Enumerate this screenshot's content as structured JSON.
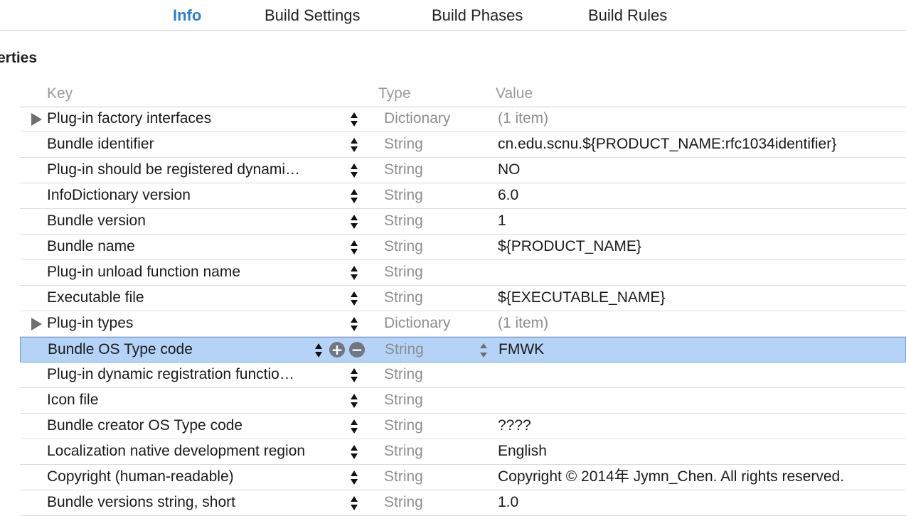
{
  "tabs": [
    {
      "label": "Info",
      "active": true
    },
    {
      "label": "Build Settings",
      "active": false
    },
    {
      "label": "Build Phases",
      "active": false
    },
    {
      "label": "Build Rules",
      "active": false
    }
  ],
  "section_title": "erties",
  "columns": {
    "key": "Key",
    "type": "Type",
    "value": "Value"
  },
  "colors": {
    "accent": "#2f7bd8",
    "selection": "#b5d3f7",
    "muted_text": "#8e8e8e"
  },
  "icons": {
    "disclosure": "disclosure-triangle-icon",
    "stepper": "up-down-stepper-icon",
    "add": "plus-circle-icon",
    "remove": "minus-circle-icon"
  },
  "rows": [
    {
      "key": "Plug-in factory interfaces",
      "type": "Dictionary",
      "value": "(1 item)",
      "expandable": true
    },
    {
      "key": "Bundle identifier",
      "type": "String",
      "value": "cn.edu.scnu.${PRODUCT_NAME:rfc1034identifier}"
    },
    {
      "key": "Plug-in should be registered dynami…",
      "type": "String",
      "value": "NO"
    },
    {
      "key": "InfoDictionary version",
      "type": "String",
      "value": "6.0"
    },
    {
      "key": "Bundle version",
      "type": "String",
      "value": "1"
    },
    {
      "key": "Bundle name",
      "type": "String",
      "value": "${PRODUCT_NAME}"
    },
    {
      "key": "Plug-in unload function name",
      "type": "String",
      "value": ""
    },
    {
      "key": "Executable file",
      "type": "String",
      "value": "${EXECUTABLE_NAME}"
    },
    {
      "key": "Plug-in types",
      "type": "Dictionary",
      "value": "(1 item)",
      "expandable": true
    },
    {
      "key": "Bundle OS Type code",
      "type": "String",
      "value": "FMWK",
      "selected": true
    },
    {
      "key": "Plug-in dynamic registration functio…",
      "type": "String",
      "value": ""
    },
    {
      "key": "Icon file",
      "type": "String",
      "value": ""
    },
    {
      "key": "Bundle creator OS Type code",
      "type": "String",
      "value": "????"
    },
    {
      "key": "Localization native development region",
      "type": "String",
      "value": "English"
    },
    {
      "key": "Copyright (human-readable)",
      "type": "String",
      "value": "Copyright © 2014年 Jymn_Chen. All rights reserved."
    },
    {
      "key": "Bundle versions string, short",
      "type": "String",
      "value": "1.0"
    }
  ]
}
